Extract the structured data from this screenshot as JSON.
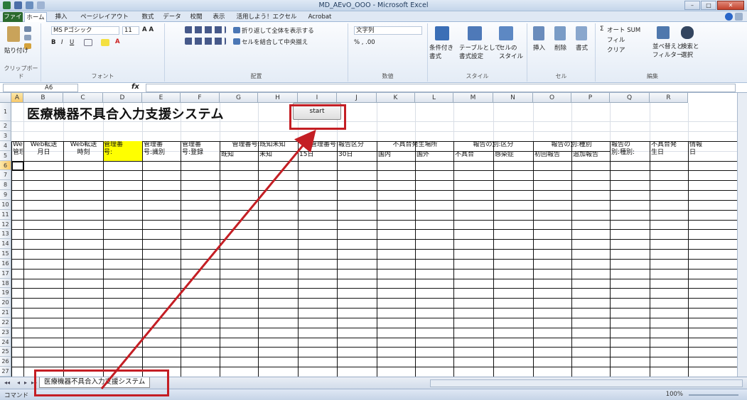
{
  "window": {
    "title": "MD_AEvO_OOO - Microsoft Excel"
  },
  "tabs": [
    "ファイル",
    "ホーム",
    "挿入",
    "ページレイアウト",
    "数式",
    "データ",
    "校閲",
    "表示",
    "活用しよう！エクセル",
    "Acrobat"
  ],
  "ribbon": {
    "clipboard": {
      "paste": "貼り付け",
      "label": "クリップボード"
    },
    "font": {
      "name": "MS Pゴシック",
      "size": "11",
      "label": "フォント"
    },
    "alignment": {
      "wrap": "折り返して全体を表示する",
      "merge": "セルを結合して中央揃え",
      "label": "配置"
    },
    "number": {
      "format": "文字列",
      "label": "数値"
    },
    "styles": {
      "conditional": "条件付き\n書式",
      "table": "テーブルとして\n書式設定",
      "cell": "セルの\nスタイル",
      "label": "スタイル"
    },
    "cells": {
      "insert": "挿入",
      "delete": "削除",
      "format": "書式",
      "label": "セル"
    },
    "editing": {
      "autosum": "オート SUM",
      "fill": "フィル",
      "clear": "クリア",
      "sort": "並べ替えと\nフィルター",
      "find": "検索と\n選択",
      "label": "編集"
    }
  },
  "formula_bar": {
    "name_box": "A6",
    "fx": "fx"
  },
  "columns": [
    "A",
    "B",
    "C",
    "D",
    "E",
    "F",
    "G",
    "H",
    "I",
    "J",
    "K",
    "L",
    "M",
    "N",
    "O",
    "P",
    "Q",
    "R"
  ],
  "rows": [
    "1",
    "2",
    "3",
    "4",
    "5",
    "6",
    "7",
    "8",
    "9",
    "10",
    "11",
    "12",
    "13",
    "14",
    "15",
    "16",
    "17",
    "18",
    "19",
    "20",
    "21",
    "22",
    "23",
    "24",
    "25",
    "26",
    "27"
  ],
  "sheet": {
    "title": "医療機器不具合入力支援システム",
    "start_button": "start",
    "headers": [
      {
        "text": "Web転送\n管理番号"
      },
      {
        "text": "Web転送\n月日"
      },
      {
        "text": "Web転送\n時刻"
      },
      {
        "text": "管理番\n号:"
      },
      {
        "text": "管理番\n号:識別"
      },
      {
        "text": "管理番\n号:登録"
      },
      {
        "text": "管理番号:既知未知",
        "sub": [
          "既知",
          "未知"
        ]
      },
      {
        "text": "管理番号:報告区分",
        "sub": [
          "15日",
          "30日"
        ]
      },
      {
        "text": "不具合発生場所",
        "sub": [
          "国内",
          "国外"
        ]
      },
      {
        "text": "報告の別:区分",
        "sub": [
          "不具合",
          "感染症"
        ]
      },
      {
        "text": "報告の別:種別",
        "sub": [
          "初回報告",
          "追加報告"
        ]
      },
      {
        "text": "報告の\n別:種別:"
      },
      {
        "text": "不具合発\n生日"
      },
      {
        "text": "情報\n日"
      }
    ]
  },
  "sheet_tabs": {
    "active": "医療機器不具合入力支援システム"
  },
  "status": {
    "left": "コマンド",
    "zoom": "100%"
  },
  "colors": {
    "annotation_red": "#c41e24",
    "highlight_yellow": "#ffff00",
    "excel_green": "#2b6a2e"
  }
}
